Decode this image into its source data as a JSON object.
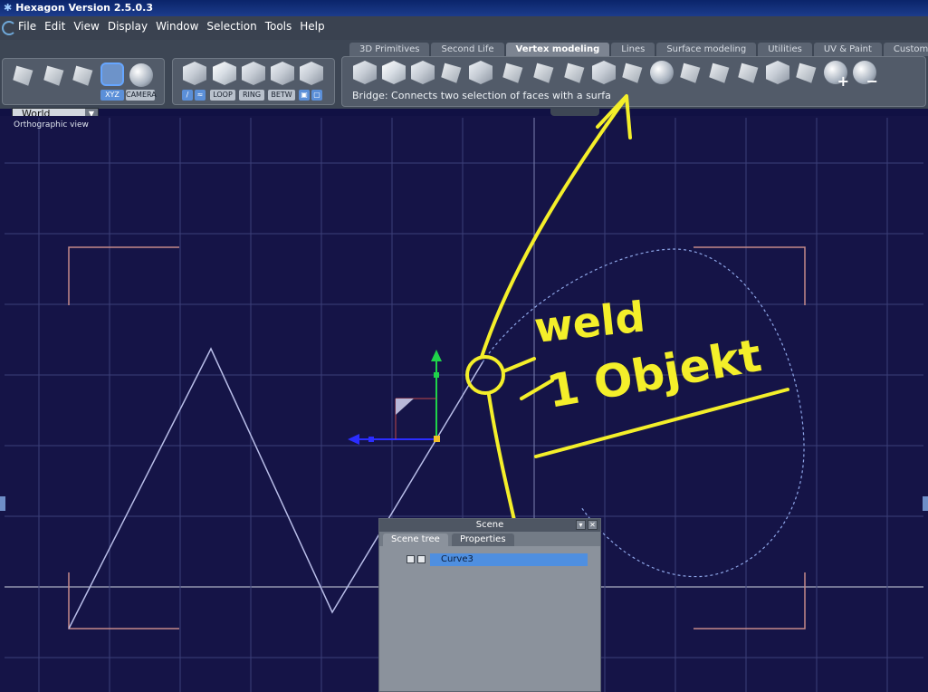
{
  "window": {
    "title": "Hexagon Version 2.5.0.3"
  },
  "menu": {
    "items": [
      "File",
      "Edit",
      "View",
      "Display",
      "Window",
      "Selection",
      "Tools",
      "Help"
    ]
  },
  "tabs": [
    "3D Primitives",
    "Second Life",
    "Vertex modeling",
    "Lines",
    "Surface modeling",
    "Utilities",
    "UV & Paint",
    "Custom"
  ],
  "active_tab": "Vertex modeling",
  "toolbar": {
    "coord_space": "World",
    "xyz_label": "XYZ",
    "camera_label": "CAMERA",
    "loop_label": "LOOP",
    "ring_label": "RING",
    "betw_label": "BETW",
    "status_text": "Bridge: Connects two selection of faces with a surfa"
  },
  "viewport": {
    "label": "Orthographic view"
  },
  "scene_panel": {
    "title": "Scene",
    "tabs": [
      "Scene tree",
      "Properties"
    ],
    "items": [
      {
        "name": "Curve3"
      }
    ]
  },
  "annotations": {
    "line1": "weld",
    "line2": "1 Objekt",
    "color": "#f4ef2a"
  },
  "colors": {
    "viewport_bg": "#151447",
    "grid": "#3b3f78",
    "accent": "#4f8fe0"
  }
}
